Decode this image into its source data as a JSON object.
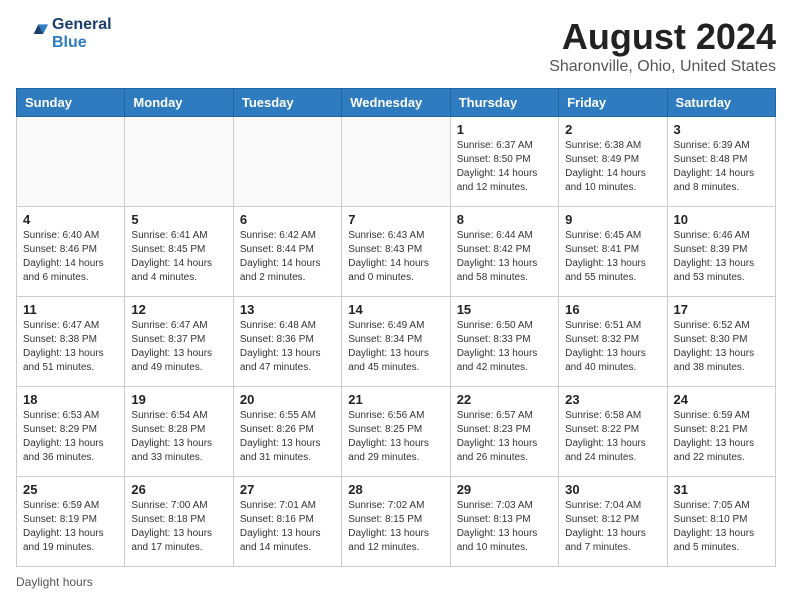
{
  "header": {
    "logo_line1": "General",
    "logo_line2": "Blue",
    "main_title": "August 2024",
    "subtitle": "Sharonville, Ohio, United States"
  },
  "weekdays": [
    "Sunday",
    "Monday",
    "Tuesday",
    "Wednesday",
    "Thursday",
    "Friday",
    "Saturday"
  ],
  "weeks": [
    [
      {
        "day": "",
        "info": ""
      },
      {
        "day": "",
        "info": ""
      },
      {
        "day": "",
        "info": ""
      },
      {
        "day": "",
        "info": ""
      },
      {
        "day": "1",
        "info": "Sunrise: 6:37 AM\nSunset: 8:50 PM\nDaylight: 14 hours\nand 12 minutes."
      },
      {
        "day": "2",
        "info": "Sunrise: 6:38 AM\nSunset: 8:49 PM\nDaylight: 14 hours\nand 10 minutes."
      },
      {
        "day": "3",
        "info": "Sunrise: 6:39 AM\nSunset: 8:48 PM\nDaylight: 14 hours\nand 8 minutes."
      }
    ],
    [
      {
        "day": "4",
        "info": "Sunrise: 6:40 AM\nSunset: 8:46 PM\nDaylight: 14 hours\nand 6 minutes."
      },
      {
        "day": "5",
        "info": "Sunrise: 6:41 AM\nSunset: 8:45 PM\nDaylight: 14 hours\nand 4 minutes."
      },
      {
        "day": "6",
        "info": "Sunrise: 6:42 AM\nSunset: 8:44 PM\nDaylight: 14 hours\nand 2 minutes."
      },
      {
        "day": "7",
        "info": "Sunrise: 6:43 AM\nSunset: 8:43 PM\nDaylight: 14 hours\nand 0 minutes."
      },
      {
        "day": "8",
        "info": "Sunrise: 6:44 AM\nSunset: 8:42 PM\nDaylight: 13 hours\nand 58 minutes."
      },
      {
        "day": "9",
        "info": "Sunrise: 6:45 AM\nSunset: 8:41 PM\nDaylight: 13 hours\nand 55 minutes."
      },
      {
        "day": "10",
        "info": "Sunrise: 6:46 AM\nSunset: 8:39 PM\nDaylight: 13 hours\nand 53 minutes."
      }
    ],
    [
      {
        "day": "11",
        "info": "Sunrise: 6:47 AM\nSunset: 8:38 PM\nDaylight: 13 hours\nand 51 minutes."
      },
      {
        "day": "12",
        "info": "Sunrise: 6:47 AM\nSunset: 8:37 PM\nDaylight: 13 hours\nand 49 minutes."
      },
      {
        "day": "13",
        "info": "Sunrise: 6:48 AM\nSunset: 8:36 PM\nDaylight: 13 hours\nand 47 minutes."
      },
      {
        "day": "14",
        "info": "Sunrise: 6:49 AM\nSunset: 8:34 PM\nDaylight: 13 hours\nand 45 minutes."
      },
      {
        "day": "15",
        "info": "Sunrise: 6:50 AM\nSunset: 8:33 PM\nDaylight: 13 hours\nand 42 minutes."
      },
      {
        "day": "16",
        "info": "Sunrise: 6:51 AM\nSunset: 8:32 PM\nDaylight: 13 hours\nand 40 minutes."
      },
      {
        "day": "17",
        "info": "Sunrise: 6:52 AM\nSunset: 8:30 PM\nDaylight: 13 hours\nand 38 minutes."
      }
    ],
    [
      {
        "day": "18",
        "info": "Sunrise: 6:53 AM\nSunset: 8:29 PM\nDaylight: 13 hours\nand 36 minutes."
      },
      {
        "day": "19",
        "info": "Sunrise: 6:54 AM\nSunset: 8:28 PM\nDaylight: 13 hours\nand 33 minutes."
      },
      {
        "day": "20",
        "info": "Sunrise: 6:55 AM\nSunset: 8:26 PM\nDaylight: 13 hours\nand 31 minutes."
      },
      {
        "day": "21",
        "info": "Sunrise: 6:56 AM\nSunset: 8:25 PM\nDaylight: 13 hours\nand 29 minutes."
      },
      {
        "day": "22",
        "info": "Sunrise: 6:57 AM\nSunset: 8:23 PM\nDaylight: 13 hours\nand 26 minutes."
      },
      {
        "day": "23",
        "info": "Sunrise: 6:58 AM\nSunset: 8:22 PM\nDaylight: 13 hours\nand 24 minutes."
      },
      {
        "day": "24",
        "info": "Sunrise: 6:59 AM\nSunset: 8:21 PM\nDaylight: 13 hours\nand 22 minutes."
      }
    ],
    [
      {
        "day": "25",
        "info": "Sunrise: 6:59 AM\nSunset: 8:19 PM\nDaylight: 13 hours\nand 19 minutes."
      },
      {
        "day": "26",
        "info": "Sunrise: 7:00 AM\nSunset: 8:18 PM\nDaylight: 13 hours\nand 17 minutes."
      },
      {
        "day": "27",
        "info": "Sunrise: 7:01 AM\nSunset: 8:16 PM\nDaylight: 13 hours\nand 14 minutes."
      },
      {
        "day": "28",
        "info": "Sunrise: 7:02 AM\nSunset: 8:15 PM\nDaylight: 13 hours\nand 12 minutes."
      },
      {
        "day": "29",
        "info": "Sunrise: 7:03 AM\nSunset: 8:13 PM\nDaylight: 13 hours\nand 10 minutes."
      },
      {
        "day": "30",
        "info": "Sunrise: 7:04 AM\nSunset: 8:12 PM\nDaylight: 13 hours\nand 7 minutes."
      },
      {
        "day": "31",
        "info": "Sunrise: 7:05 AM\nSunset: 8:10 PM\nDaylight: 13 hours\nand 5 minutes."
      }
    ]
  ],
  "footer": {
    "note": "Daylight hours"
  }
}
